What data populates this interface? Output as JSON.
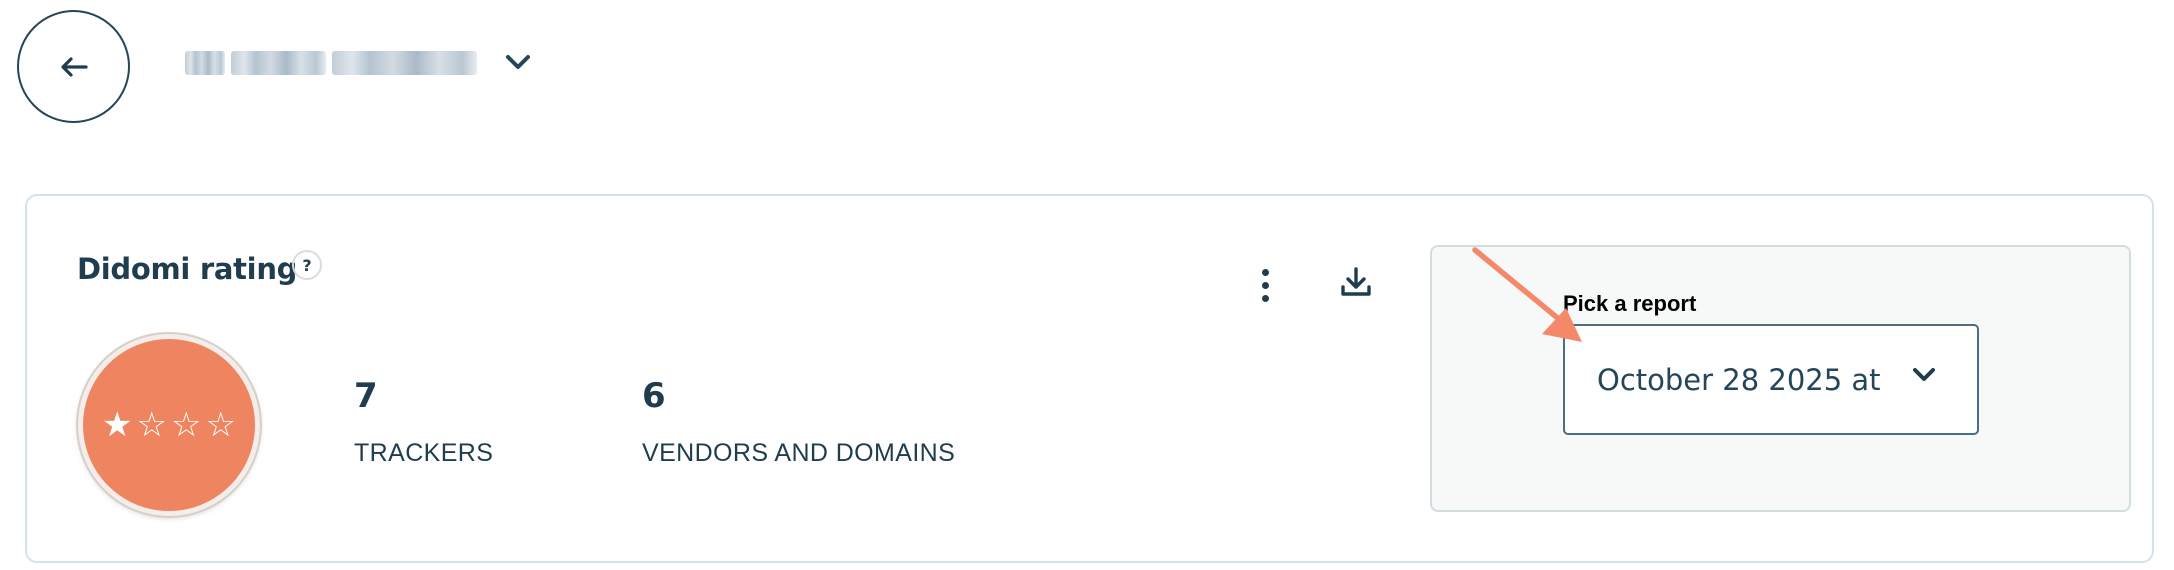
{
  "header": {
    "back_icon": "arrow-left-icon",
    "site_chevron_icon": "chevron-down-icon"
  },
  "card": {
    "title": "Didomi rating",
    "help_label": "?",
    "rating": {
      "stars_filled": 1,
      "stars_total": 4,
      "filled_star": "★",
      "empty_star": "☆",
      "color": "#ef8560"
    },
    "stats": [
      {
        "value": "7",
        "label": "TRACKERS"
      },
      {
        "value": "6",
        "label": "VENDORS AND DOMAINS"
      }
    ],
    "actions": {
      "more_icon": "kebab-menu-icon",
      "download_icon": "download-icon"
    },
    "report": {
      "label": "Pick a report",
      "selected": "October 28 2025 at",
      "chevron_icon": "chevron-down-icon"
    }
  },
  "colors": {
    "text_primary": "#1f3d4f",
    "card_border": "#d3e3ea",
    "panel_bg": "#f7f8f8",
    "annotation_arrow": "#f4896a"
  }
}
